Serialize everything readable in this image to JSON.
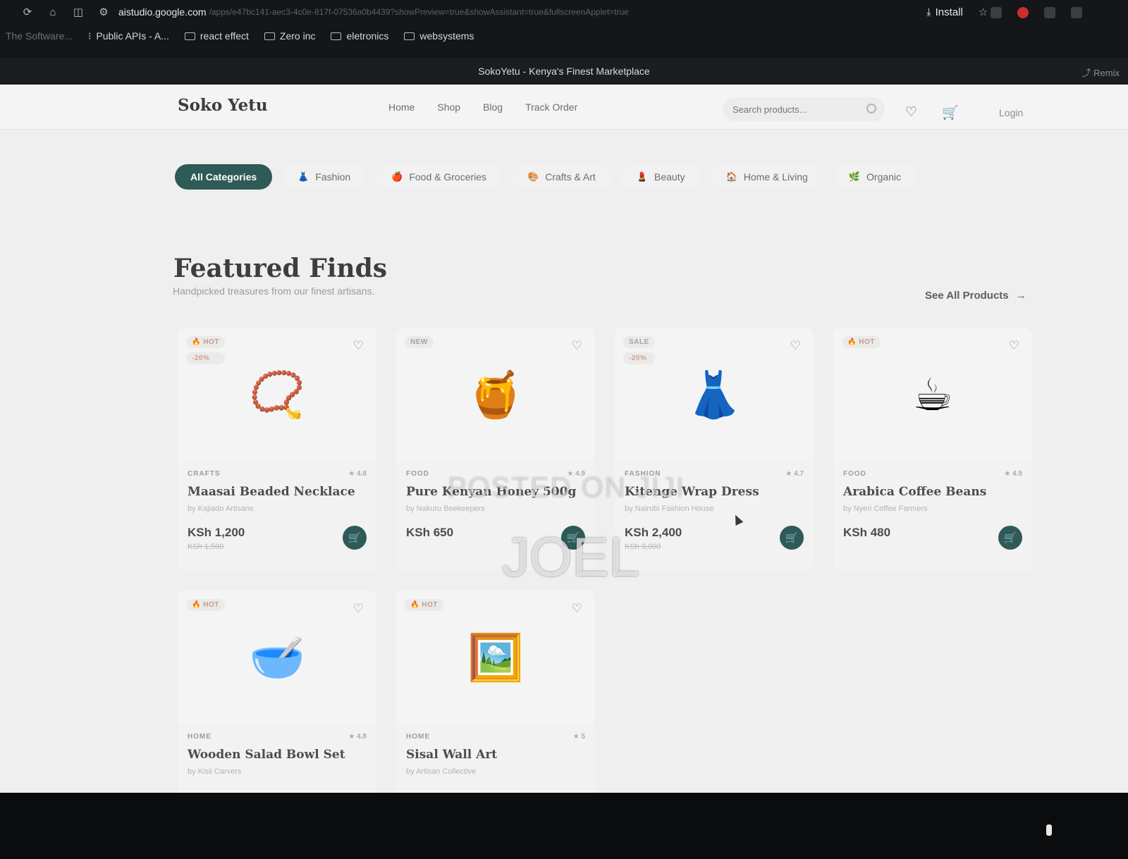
{
  "browser": {
    "url": "aistudio.google.com",
    "url_rest": "/apps/e47bc141-aec3-4c0e-817f-07536a0b4439?showPreview=true&showAssistant=true&fullscreenApplet=true",
    "install_label": "Install",
    "bookmarks": [
      {
        "label": "The Software..."
      },
      {
        "label": "Public APIs - A..."
      },
      {
        "label": "react effect"
      },
      {
        "label": "Zero inc"
      },
      {
        "label": "eletronics"
      },
      {
        "label": "websystems"
      }
    ],
    "app_title": "SokoYetu - Kenya's Finest Marketplace",
    "remix_label": "Remix"
  },
  "header": {
    "logo": "Soko Yetu",
    "nav": [
      "Home",
      "Shop",
      "Blog",
      "Track Order"
    ],
    "search_placeholder": "Search products...",
    "login": "Login"
  },
  "categories": [
    {
      "label": "All Categories",
      "active": true,
      "icon": ""
    },
    {
      "label": "Fashion",
      "icon": "👗"
    },
    {
      "label": "Food & Groceries",
      "icon": "🍎"
    },
    {
      "label": "Crafts & Art",
      "icon": "🎨"
    },
    {
      "label": "Beauty",
      "icon": "💄"
    },
    {
      "label": "Home & Living",
      "icon": "🏠"
    },
    {
      "label": "Organic",
      "icon": "🌿"
    }
  ],
  "featured": {
    "title": "Featured Finds",
    "subtitle": "Handpicked treasures from our finest artisans.",
    "see_all": "See All Products"
  },
  "products": [
    {
      "badges": [
        "🔥 HOT",
        "-20%"
      ],
      "emoji": "📿",
      "category": "CRAFTS",
      "rating": "4.8",
      "name": "Maasai Beaded Necklace",
      "seller": "by Kajiado Artisans",
      "price": "KSh 1,200",
      "old_price": "KSh 1,500"
    },
    {
      "badges": [
        "NEW"
      ],
      "emoji": "🍯",
      "category": "FOOD",
      "rating": "4.9",
      "name": "Pure Kenyan Honey 500g",
      "seller": "by Nakuru Beekeepers",
      "price": "KSh 650",
      "old_price": ""
    },
    {
      "badges": [
        "SALE",
        "-20%"
      ],
      "emoji": "👗",
      "category": "FASHION",
      "rating": "4.7",
      "name": "Kitenge Wrap Dress",
      "seller": "by Nairobi Fashion House",
      "price": "KSh 2,400",
      "old_price": "KSh 3,000"
    },
    {
      "badges": [
        "🔥 HOT"
      ],
      "emoji": "☕",
      "category": "FOOD",
      "rating": "4.9",
      "name": "Arabica Coffee Beans",
      "seller": "by Nyeri Coffee Farmers",
      "price": "KSh 480",
      "old_price": ""
    },
    {
      "badges": [
        "🔥 HOT"
      ],
      "emoji": "🥣",
      "category": "HOME",
      "rating": "4.8",
      "name": "Wooden Salad Bowl Set",
      "seller": "by Kisii Carvers",
      "price": "",
      "old_price": ""
    },
    {
      "badges": [
        "🔥 HOT"
      ],
      "emoji": "🖼️",
      "category": "HOME",
      "rating": "5",
      "name": "Sisal Wall Art",
      "seller": "by Artisan Collective",
      "price": "",
      "old_price": ""
    }
  ],
  "watermark": {
    "line1": "POSTED ON JIJI",
    "line2": "JOEL"
  }
}
